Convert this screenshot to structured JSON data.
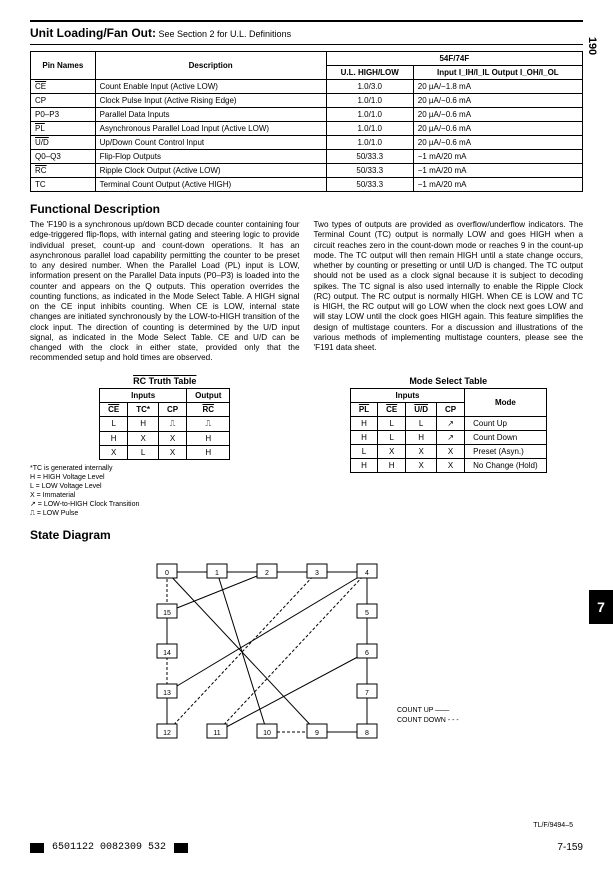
{
  "page_number": "190",
  "title": {
    "main": "Unit Loading/Fan Out:",
    "sub": "See Section 2 for U.L. Definitions"
  },
  "pins": {
    "group_header": "54F/74F",
    "cols": [
      "Pin Names",
      "Description",
      "U.L. HIGH/LOW",
      "Input I_IH/I_IL Output I_OH/I_OL"
    ],
    "rows": [
      {
        "pin": "CE",
        "ov": true,
        "desc": "Count Enable Input (Active LOW)",
        "ul": "1.0/3.0",
        "io": "20 µA/−1.8 mA"
      },
      {
        "pin": "CP",
        "ov": false,
        "desc": "Clock Pulse Input (Active Rising Edge)",
        "ul": "1.0/1.0",
        "io": "20 µA/−0.6 mA"
      },
      {
        "pin": "P0–P3",
        "ov": false,
        "desc": "Parallel Data Inputs",
        "ul": "1.0/1.0",
        "io": "20 µA/−0.6 mA"
      },
      {
        "pin": "PL",
        "ov": true,
        "desc": "Asynchronous Parallel Load Input (Active LOW)",
        "ul": "1.0/1.0",
        "io": "20 µA/−0.6 mA"
      },
      {
        "pin": "U/D",
        "ov": true,
        "desc": "Up/Down Count Control Input",
        "ul": "1.0/1.0",
        "io": "20 µA/−0.6 mA"
      },
      {
        "pin": "Q0–Q3",
        "ov": false,
        "desc": "Flip-Flop Outputs",
        "ul": "50/33.3",
        "io": "−1 mA/20 mA"
      },
      {
        "pin": "RC",
        "ov": true,
        "desc": "Ripple Clock Output (Active LOW)",
        "ul": "50/33.3",
        "io": "−1 mA/20 mA"
      },
      {
        "pin": "TC",
        "ov": false,
        "desc": "Terminal Count Output (Active HIGH)",
        "ul": "50/33.3",
        "io": "−1 mA/20 mA"
      }
    ]
  },
  "func_heading": "Functional Description",
  "func_p1": "The 'F190 is a synchronous up/down BCD decade counter containing four edge-triggered flip-flops, with internal gating and steering logic to provide individual preset, count-up and count-down operations. It has an asynchronous parallel load capability permitting the counter to be preset to any desired number. When the Parallel Load (PL) input is LOW, information present on the Parallel Data inputs (P0–P3) is loaded into the counter and appears on the Q outputs. This operation overrides the counting functions, as indicated in the Mode Select Table. A HIGH signal on the CE input inhibits counting. When CE is LOW, internal state changes are initiated synchronously by the LOW-to-HIGH transition of the clock input. The direction of counting is determined by the U/D input signal, as indicated in the Mode Select Table. CE and U/D can be changed with the clock in either state, provided only that the recommended setup and hold times are observed.",
  "func_p2": "Two types of outputs are provided as overflow/underflow indicators. The Terminal Count (TC) output is normally LOW and goes HIGH when a circuit reaches zero in the count-down mode or reaches 9 in the count-up mode. The TC output will then remain HIGH until a state change occurs, whether by counting or presetting or until U/D is changed. The TC output should not be used as a clock signal because it is subject to decoding spikes. The TC signal is also used internally to enable the Ripple Clock (RC) output. The RC output is normally HIGH. When CE is LOW and TC is HIGH, the RC output will go LOW when the clock next goes LOW and will stay LOW until the clock goes HIGH again. This feature simplifies the design of multistage counters. For a discussion and illustrations of the various methods of implementing multistage counters, please see the 'F191 data sheet.",
  "rc_table": {
    "title": "RC Truth Table",
    "head_inputs": "Inputs",
    "head_output": "Output",
    "cols": [
      "CE",
      "TC*",
      "CP",
      "RC"
    ],
    "rows": [
      [
        "L",
        "H",
        "⎍",
        "⎍"
      ],
      [
        "H",
        "X",
        "X",
        "H"
      ],
      [
        "X",
        "L",
        "X",
        "H"
      ]
    ]
  },
  "notes": [
    "*TC is generated internally",
    "H = HIGH Voltage Level",
    "L = LOW Voltage Level",
    "X = Immaterial",
    "↗ = LOW-to-HIGH Clock Transition",
    "⎍ = LOW Pulse"
  ],
  "mode_table": {
    "title": "Mode Select Table",
    "head_inputs": "Inputs",
    "head_mode": "Mode",
    "cols": [
      "PL",
      "CE",
      "U/D",
      "CP"
    ],
    "rows": [
      {
        "c": [
          "H",
          "L",
          "L",
          "↗"
        ],
        "m": "Count Up"
      },
      {
        "c": [
          "H",
          "L",
          "H",
          "↗"
        ],
        "m": "Count Down"
      },
      {
        "c": [
          "L",
          "X",
          "X",
          "X"
        ],
        "m": "Preset (Asyn.)"
      },
      {
        "c": [
          "H",
          "H",
          "X",
          "X"
        ],
        "m": "No Change (Hold)"
      }
    ]
  },
  "state_heading": "State Diagram",
  "state_legend": {
    "up": "COUNT UP",
    "down": "COUNT DOWN"
  },
  "tlf": "TL/F/9494–5",
  "footer": {
    "code": "6501122 0082309 532",
    "page": "7-159"
  },
  "side_tab": "7",
  "chart_data": {
    "type": "state_diagram",
    "states": [
      0,
      1,
      2,
      3,
      4,
      5,
      6,
      7,
      8,
      9,
      10,
      11,
      12,
      13,
      14,
      15
    ],
    "count_up_cycle": [
      0,
      1,
      2,
      3,
      4,
      5,
      6,
      7,
      8,
      9,
      0
    ],
    "count_down_cycle": [
      9,
      8,
      7,
      6,
      5,
      4,
      3,
      2,
      1,
      0,
      9
    ],
    "unused_states_up": {
      "10": 1,
      "11": 6,
      "12": 13,
      "13": 4,
      "14": 15,
      "15": 2
    },
    "unused_states_down": {
      "10": 9,
      "11": 4,
      "12": 3,
      "13": 12,
      "14": 13,
      "15": 0
    },
    "legend": {
      "solid": "COUNT UP",
      "dashed": "COUNT DOWN"
    }
  }
}
